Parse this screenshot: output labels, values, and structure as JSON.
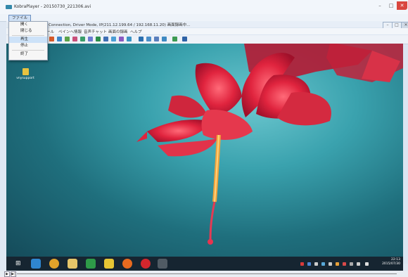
{
  "window": {
    "title": "KobraPlayer - 20150730_221306.avi",
    "controls": {
      "minimize": "–",
      "maximize": "□",
      "close": "✕"
    }
  },
  "menubar": {
    "file": "ファイル"
  },
  "file_menu": {
    "items": [
      "開く",
      "閉じる",
      "再生",
      "停止",
      "終了"
    ]
  },
  "inner_window": {
    "title": "P Connection, Driver Mode, IP(211.12.199.64 / 192.168.11.20) 画面録画中...",
    "menu": [
      "ール",
      "ペインヘ情報",
      "音声チャット",
      "画面の録画",
      "ヘルプ"
    ],
    "controls": {
      "minimize": "–",
      "maximize": "□",
      "close": "✕"
    }
  },
  "desktop": {
    "icon_label": "vnysupport"
  },
  "taskbar": {
    "start_glyph": "⊞",
    "time": "22:13",
    "date": "2015/07/30"
  },
  "statusbar": {
    "play": "▶",
    "step": "▶|"
  },
  "colors": {
    "desktop_dark": "#154b5a",
    "desktop_light": "#6cc7cf",
    "flower_red": "#e0243e",
    "taskbar": "#162531"
  }
}
